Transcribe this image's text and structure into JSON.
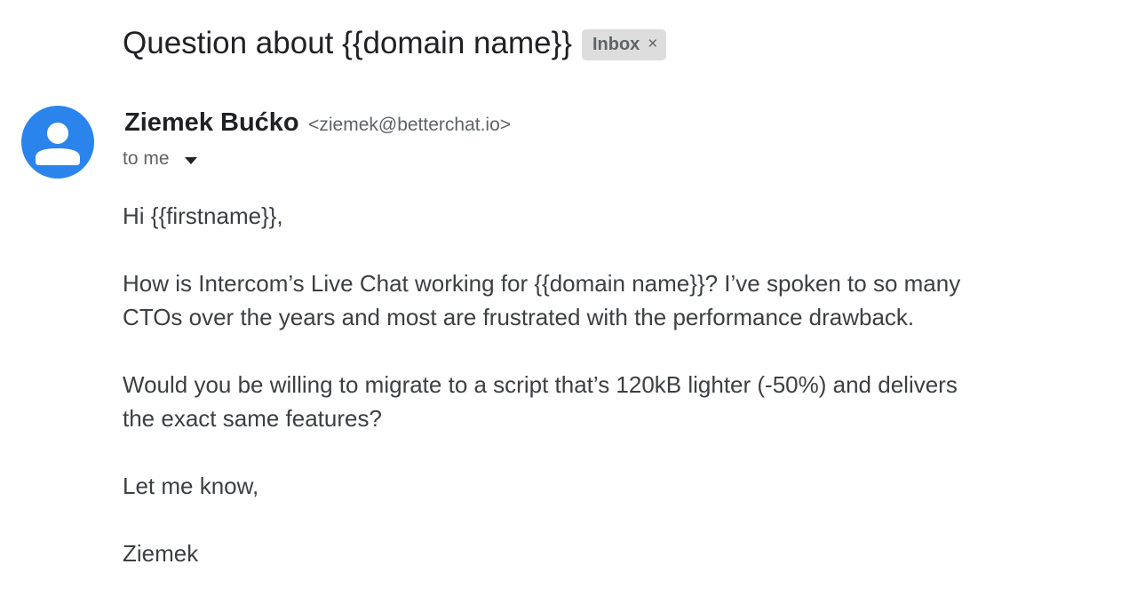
{
  "email": {
    "subject": "Question about {{domain name}}",
    "label": {
      "text": "Inbox",
      "close_glyph": "×"
    },
    "sender": {
      "name": "Ziemek Bućko",
      "email": "<ziemek@betterchat.io>",
      "avatar_icon": "default-person-icon",
      "avatar_color": "#2a84ec"
    },
    "recipient": {
      "text": "to me",
      "details_icon": "caret-down-icon"
    },
    "body": {
      "greeting": "Hi {{firstname}},",
      "paragraph_1_line_1": "How is Intercom’s Live Chat working for {{domain name}}? I’ve spoken to so many",
      "paragraph_1_line_2": "CTOs over the years and most are frustrated with the performance drawback.",
      "paragraph_2_line_1": "Would you be willing to migrate to a script that’s 120kB lighter (-50%) and delivers",
      "paragraph_2_line_2": "the exact same features?",
      "closing": "Let me know,",
      "signature": "Ziemek"
    }
  }
}
